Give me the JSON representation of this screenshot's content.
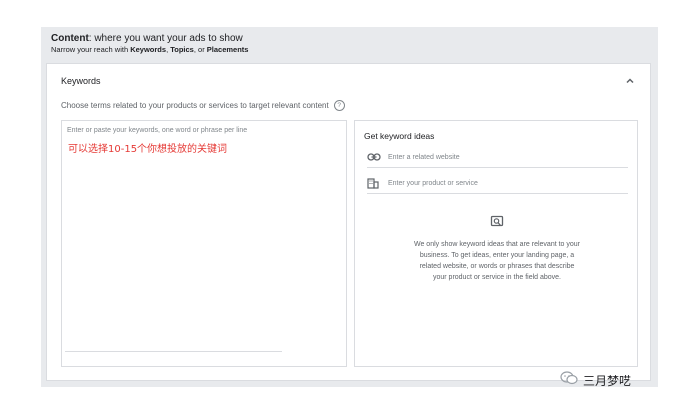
{
  "header": {
    "content_label": "Content",
    "content_desc": ": where you want your ads to show",
    "narrow_prefix": "Narrow your reach with ",
    "keywords": "Keywords",
    "sep1": ", ",
    "topics": "Topics",
    "sep2": ", or ",
    "placements": "Placements"
  },
  "card": {
    "title": "Keywords",
    "instruction": "Choose terms related to your products or services to target relevant content",
    "help_symbol": "?",
    "textarea_placeholder": "Enter or paste your keywords, one word or phrase per line",
    "note": "可以选择10-15个你想投放的关键词"
  },
  "ideas": {
    "title": "Get keyword ideas",
    "website_placeholder": "Enter a related website",
    "product_placeholder": "Enter your product or service",
    "empty_message": "We only show keyword ideas that are relevant to your business. To get ideas, enter your landing page, a related website, or words or phrases that describe your product or service in the field above."
  },
  "watermark": {
    "label": "三月梦呓"
  },
  "icons": {
    "collapse": "chevron-up-icon",
    "help": "help-circle-icon",
    "website": "link-icon",
    "product": "store-icon",
    "empty": "search-lightbulb-icon",
    "watermark": "wechat-icon"
  }
}
